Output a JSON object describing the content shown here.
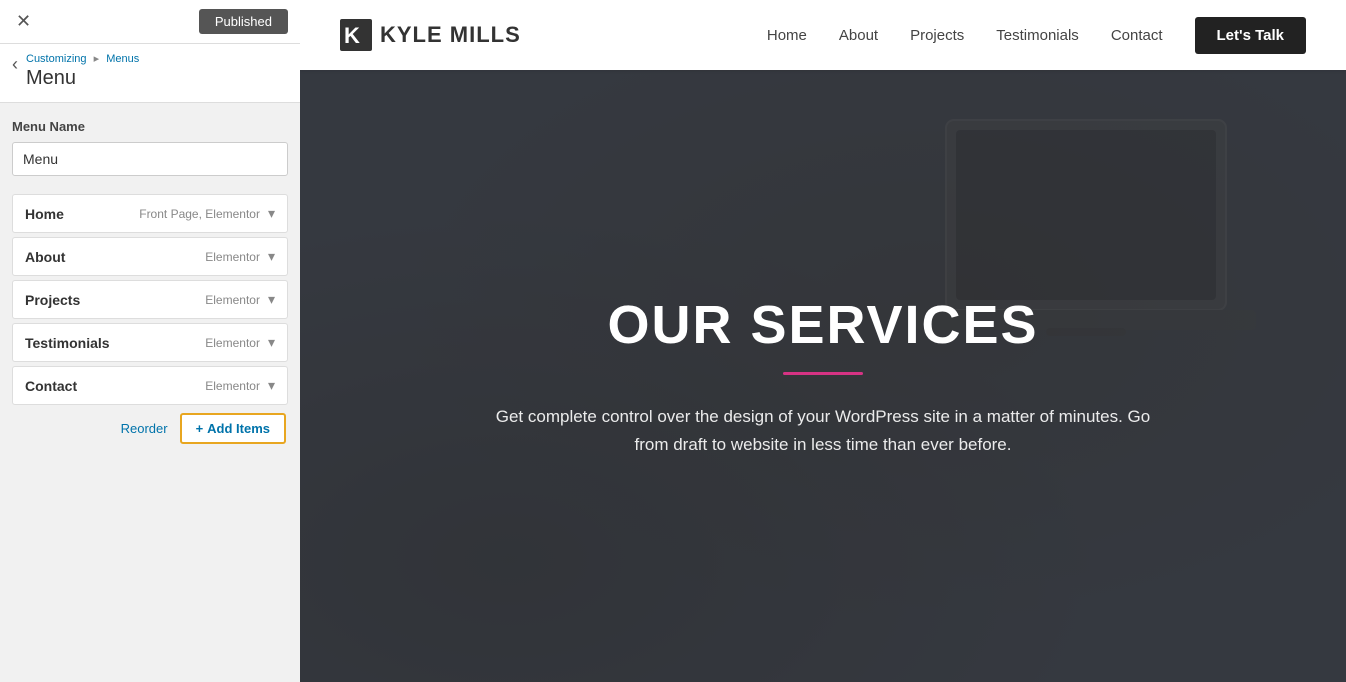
{
  "topBar": {
    "closeLabel": "✕",
    "publishedLabel": "Published"
  },
  "breadcrumb": {
    "customizingLabel": "Customizing",
    "arrow": "▸",
    "menusLabel": "Menus"
  },
  "panel": {
    "backArrow": "‹",
    "title": "Menu",
    "menuNameLabel": "Menu Name",
    "menuNameValue": "Menu",
    "menuNamePlaceholder": "Menu"
  },
  "menuItems": [
    {
      "name": "Home",
      "tag": "Front Page, Elementor"
    },
    {
      "name": "About",
      "tag": "Elementor"
    },
    {
      "name": "Projects",
      "tag": "Elementor"
    },
    {
      "name": "Testimonials",
      "tag": "Elementor"
    },
    {
      "name": "Contact",
      "tag": "Elementor"
    }
  ],
  "actions": {
    "reorderLabel": "Reorder",
    "addItemsIcon": "+",
    "addItemsLabel": "Add Items"
  },
  "site": {
    "logoText": "KYLE MILLS",
    "navLinks": [
      "Home",
      "About",
      "Projects",
      "Testimonials",
      "Contact"
    ],
    "ctaLabel": "Let's Talk",
    "heroTitle": "OUR SERVICES",
    "heroDescription": "Get complete control over the design of your WordPress site in a matter of minutes. Go from draft to website in less time than ever before."
  }
}
